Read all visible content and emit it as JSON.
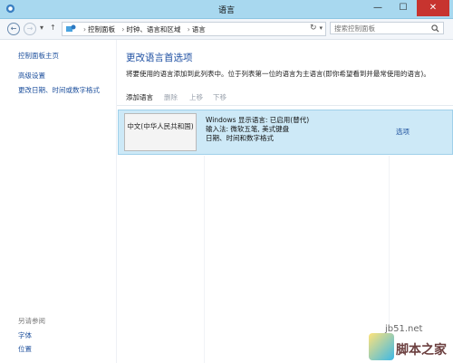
{
  "window": {
    "title": "语言",
    "min_label": "—",
    "max_label": "☐",
    "close_label": "✕"
  },
  "nav": {
    "back_label": "←",
    "forward_label": "→",
    "recent_label": "▾",
    "up_label": "↑",
    "breadcrumbs": [
      "控制面板",
      "时钟、语言和区域",
      "语言"
    ],
    "breadcrumb_sep": "›",
    "address_dropdown": "▾",
    "refresh_label": "↻",
    "search_placeholder": "搜索控制面板"
  },
  "sidebar": {
    "home": "控制面板主页",
    "links": [
      "高级设置",
      "更改日期、时间或数字格式"
    ],
    "see_also_heading": "另请参阅",
    "see_also": [
      "字体",
      "位置"
    ]
  },
  "main": {
    "heading": "更改语言首选项",
    "description": "将要使用的语言添加到此列表中。位于列表第一位的语言为主语言(即你希望看到并最常使用的语言)。",
    "toolbar": {
      "add": "添加语言",
      "remove": "删除",
      "up": "上移",
      "down": "下移"
    },
    "language": {
      "name": "中文(中华人民共和国)",
      "info": [
        "Windows 显示语言: 已启用(替代)",
        "输入法: 微软五笔, 美式键盘",
        "日期、时间和数字格式"
      ],
      "options": "选项"
    }
  },
  "watermark": {
    "url": "jb51.net",
    "brand": "脚本之家"
  },
  "colors": {
    "titlebar": "#a8d8ef",
    "close": "#c7342f",
    "link": "#1c4f9c",
    "heading": "#1e4fa2",
    "selected_row": "#cde9f7"
  }
}
